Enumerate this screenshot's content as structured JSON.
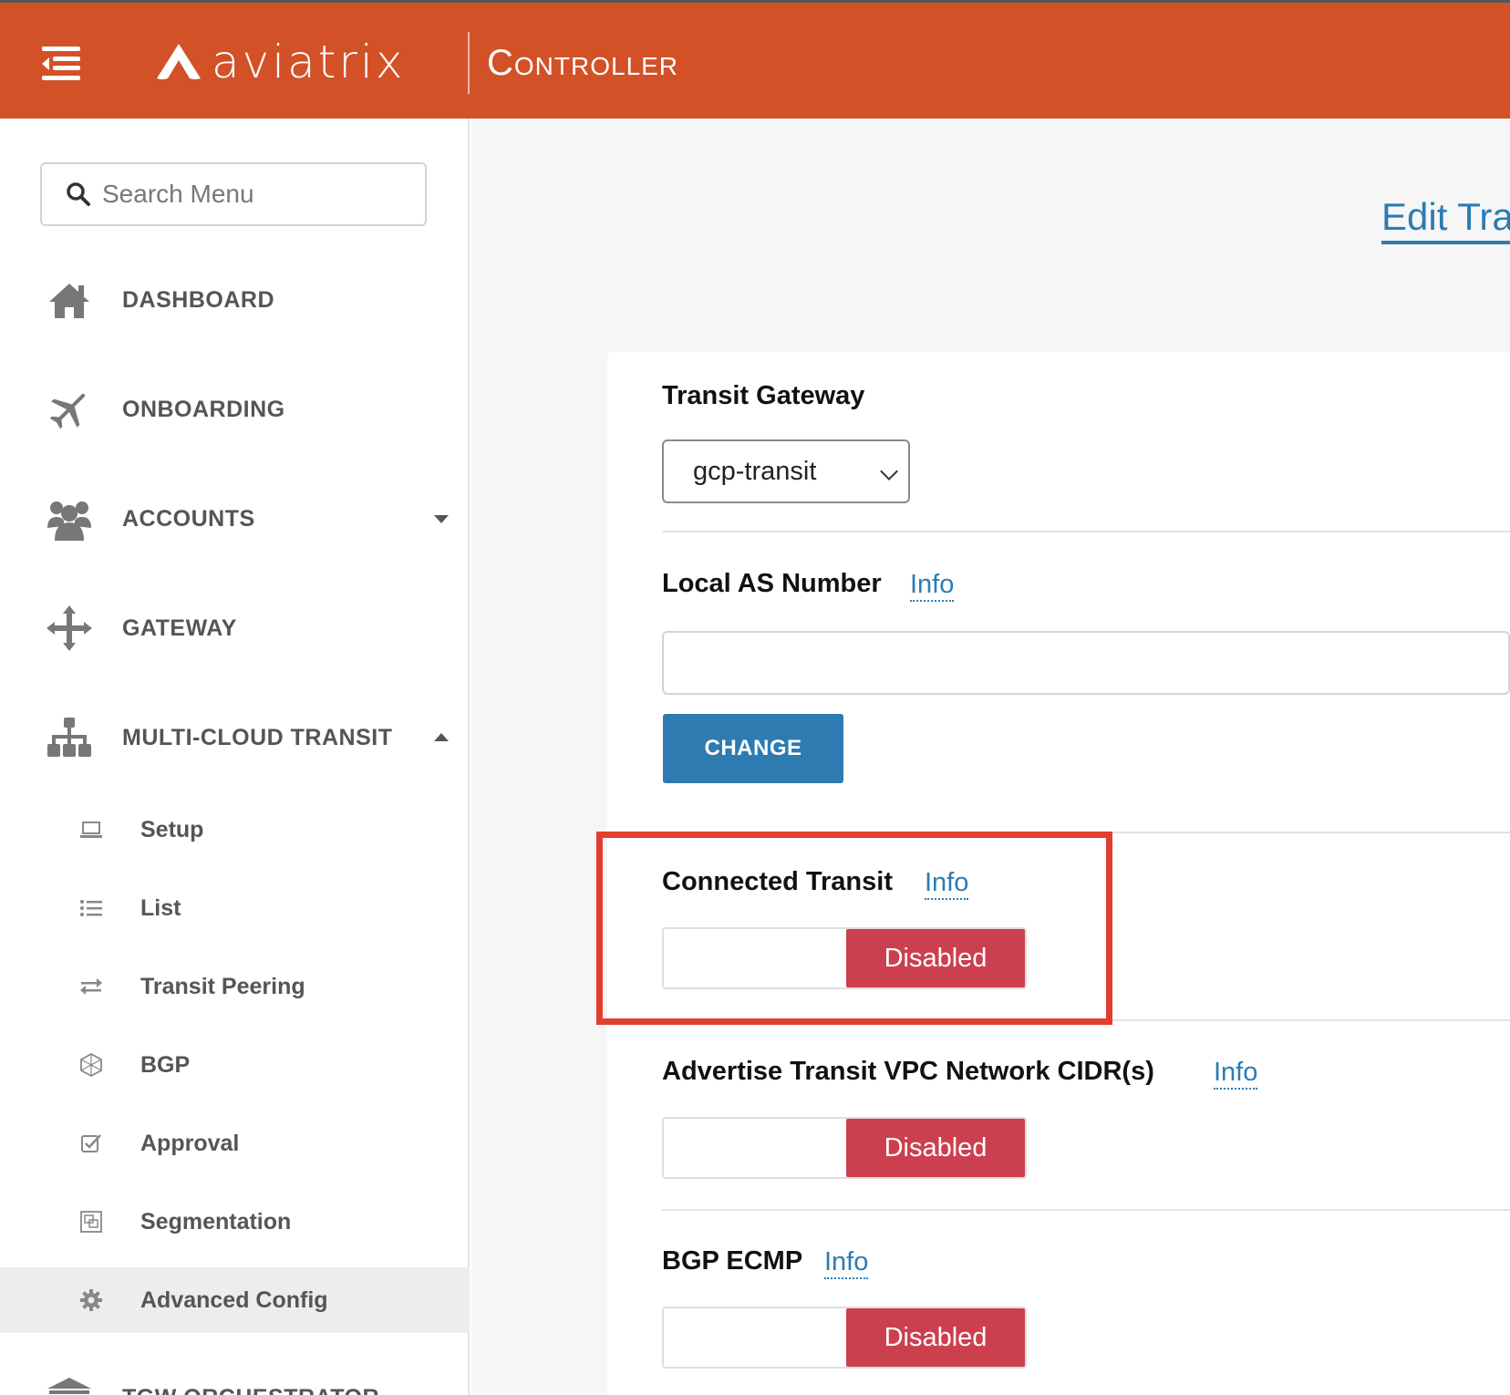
{
  "header": {
    "brand": "aviatrix",
    "product": "Controller",
    "colors": {
      "brand_bar": "#d35127"
    },
    "icons": {
      "menu": "hamburger-icon",
      "logo": "aviatrix-logo-icon"
    }
  },
  "sidebar": {
    "search": {
      "placeholder": "Search Menu",
      "value": ""
    },
    "items": [
      {
        "label": "DASHBOARD",
        "icon": "home-icon"
      },
      {
        "label": "ONBOARDING",
        "icon": "airplane-icon"
      },
      {
        "label": "ACCOUNTS",
        "icon": "users-icon",
        "expanded": false
      },
      {
        "label": "GATEWAY",
        "icon": "arrows-icon"
      },
      {
        "label": "MULTI-CLOUD TRANSIT",
        "icon": "sitemap-icon",
        "expanded": true
      },
      {
        "label": "TGW ORCHESTRATOR",
        "icon": "bank-icon"
      }
    ],
    "subitems": [
      {
        "label": "Setup",
        "icon": "laptop-icon"
      },
      {
        "label": "List",
        "icon": "list-icon"
      },
      {
        "label": "Transit Peering",
        "icon": "exchange-icon"
      },
      {
        "label": "BGP",
        "icon": "bgp-icon"
      },
      {
        "label": "Approval",
        "icon": "check-square-icon"
      },
      {
        "label": "Segmentation",
        "icon": "segmentation-icon"
      },
      {
        "label": "Advanced Config",
        "icon": "gear-icon",
        "active": true
      }
    ]
  },
  "main": {
    "page_title": "Edit Tra",
    "transit_gateway": {
      "label": "Transit Gateway",
      "selected": "gcp-transit"
    },
    "local_as": {
      "label": "Local AS Number",
      "info": "Info",
      "value": "",
      "button": "CHANGE"
    },
    "connected_transit": {
      "label": "Connected Transit",
      "info": "Info",
      "state": "Disabled"
    },
    "advertise_cidr": {
      "label": "Advertise Transit VPC Network CIDR(s)",
      "info": "Info",
      "state": "Disabled"
    },
    "bgp_ecmp": {
      "label": "BGP ECMP",
      "info": "Info",
      "state": "Disabled"
    },
    "colors": {
      "accent": "#2b7cb5",
      "disabled": "#cc3f4f",
      "highlight": "#e33e2e"
    }
  }
}
